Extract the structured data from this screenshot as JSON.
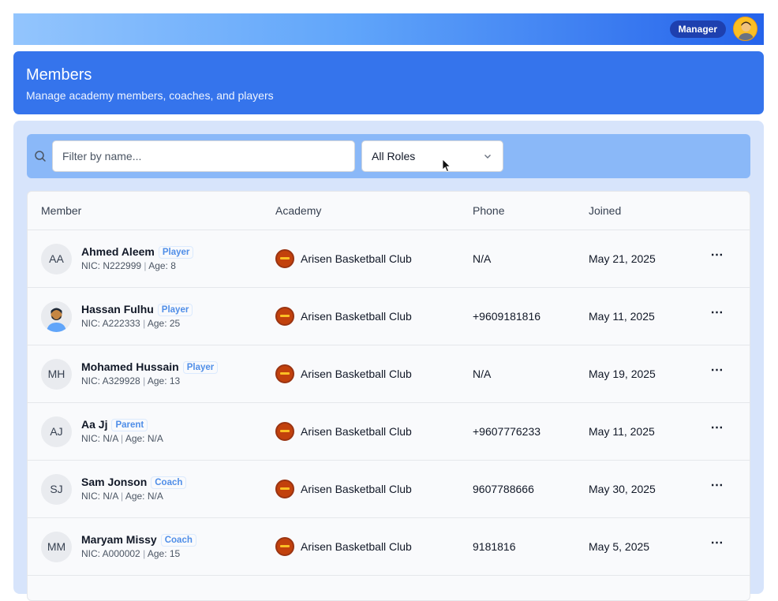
{
  "topbar": {
    "role_label": "Manager"
  },
  "header": {
    "title": "Members",
    "subtitle": "Manage academy members, coaches, and players"
  },
  "filters": {
    "search_placeholder": "Filter by name...",
    "search_value": "",
    "role_selected": "All Roles"
  },
  "table": {
    "columns": [
      "Member",
      "Academy",
      "Phone",
      "Joined"
    ],
    "rows": [
      {
        "initials": "AA",
        "photo": false,
        "name": "Ahmed Aleem",
        "role": "Player",
        "nic": "NIC: N222999",
        "age": "Age: 8",
        "academy": "Arisen Basketball Club",
        "phone": "N/A",
        "joined": "May 21, 2025"
      },
      {
        "initials": "",
        "photo": true,
        "name": "Hassan Fulhu",
        "role": "Player",
        "nic": "NIC: A222333",
        "age": "Age: 25",
        "academy": "Arisen Basketball Club",
        "phone": "+9609181816",
        "joined": "May 11, 2025"
      },
      {
        "initials": "MH",
        "photo": false,
        "name": "Mohamed Hussain",
        "role": "Player",
        "nic": "NIC: A329928",
        "age": "Age: 13",
        "academy": "Arisen Basketball Club",
        "phone": "N/A",
        "joined": "May 19, 2025"
      },
      {
        "initials": "AJ",
        "photo": false,
        "name": "Aa Jj",
        "role": "Parent",
        "nic": "NIC: N/A",
        "age": "Age: N/A",
        "academy": "Arisen Basketball Club",
        "phone": "+9607776233",
        "joined": "May 11, 2025"
      },
      {
        "initials": "SJ",
        "photo": false,
        "name": "Sam Jonson",
        "role": "Coach",
        "nic": "NIC: N/A",
        "age": "Age: N/A",
        "academy": "Arisen Basketball Club",
        "phone": "9607788666",
        "joined": "May 30, 2025"
      },
      {
        "initials": "MM",
        "photo": false,
        "name": "Maryam Missy",
        "role": "Coach",
        "nic": "NIC: A000002",
        "age": "Age: 15",
        "academy": "Arisen Basketball Club",
        "phone": "9181816",
        "joined": "May 5, 2025"
      }
    ]
  },
  "icons": {
    "search": "search-icon",
    "chevron": "chevron-down-icon",
    "more": "more-horizontal-icon",
    "academy_logo": "academy-logo-icon",
    "user_avatar": "user-avatar-icon"
  },
  "colors": {
    "accent": "#3574ec",
    "badge_text": "#4f8ee8",
    "role_pill": "#1e40af"
  }
}
